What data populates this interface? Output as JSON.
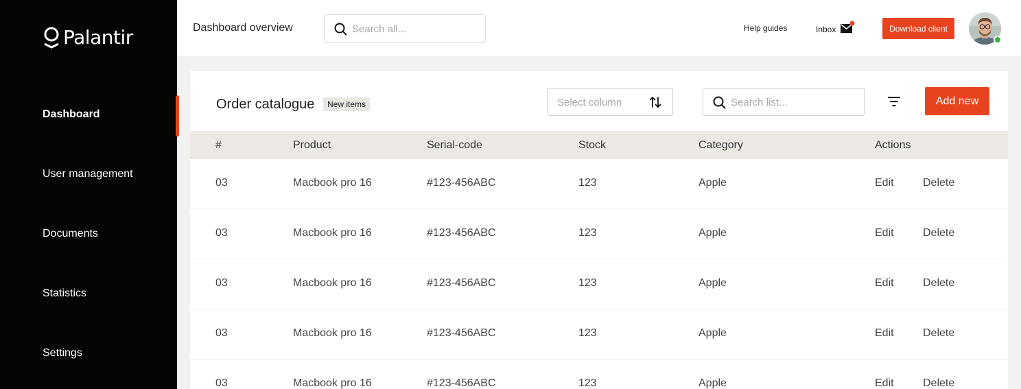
{
  "brand": {
    "name": "Palantir"
  },
  "sidebar": {
    "items": [
      {
        "label": "Dashboard",
        "active": true
      },
      {
        "label": "User management",
        "active": false
      },
      {
        "label": "Documents",
        "active": false
      },
      {
        "label": "Statistics",
        "active": false
      },
      {
        "label": "Settings",
        "active": false
      }
    ]
  },
  "header": {
    "title": "Dashboard overview",
    "search": {
      "placeholder": "Search all...",
      "value": ""
    },
    "help_label": "Help guides",
    "inbox_label": "Inbox",
    "download_label": "Download client"
  },
  "catalogue": {
    "title": "Order catalogue",
    "badge": "New items",
    "select": {
      "placeholder": "Select column"
    },
    "search": {
      "placeholder": "Search list...",
      "value": ""
    },
    "add_label": "Add new",
    "columns": [
      "#",
      "Product",
      "Serial-code",
      "Stock",
      "Category",
      "Actions"
    ],
    "rows": [
      {
        "num": "03",
        "product": "Macbook pro 16",
        "serial": "#123-456ABC",
        "stock": "123",
        "category": "Apple",
        "edit": "Edit",
        "delete": "Delete"
      },
      {
        "num": "03",
        "product": "Macbook pro 16",
        "serial": "#123-456ABC",
        "stock": "123",
        "category": "Apple",
        "edit": "Edit",
        "delete": "Delete"
      },
      {
        "num": "03",
        "product": "Macbook pro 16",
        "serial": "#123-456ABC",
        "stock": "123",
        "category": "Apple",
        "edit": "Edit",
        "delete": "Delete"
      },
      {
        "num": "03",
        "product": "Macbook pro 16",
        "serial": "#123-456ABC",
        "stock": "123",
        "category": "Apple",
        "edit": "Edit",
        "delete": "Delete"
      },
      {
        "num": "03",
        "product": "Macbook pro 16",
        "serial": "#123-456ABC",
        "stock": "123",
        "category": "Apple",
        "edit": "Edit",
        "delete": "Delete"
      }
    ]
  },
  "colors": {
    "accent": "#e8431f",
    "sidebar_bg": "#050505",
    "table_header_bg": "#ece9e4",
    "online": "#3bb54a"
  },
  "icons": [
    "palantir-logo-icon",
    "search-icon",
    "inbox-icon",
    "sort-icon",
    "filter-icon"
  ]
}
